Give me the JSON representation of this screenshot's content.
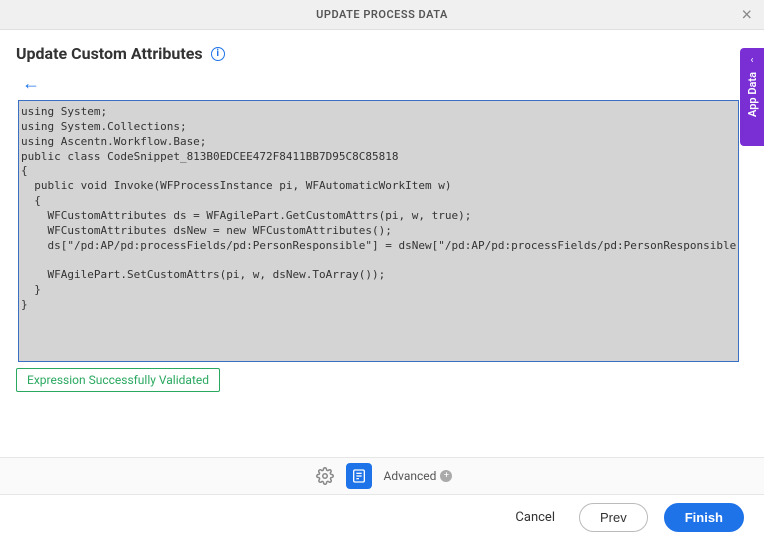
{
  "modal": {
    "title": "UPDATE PROCESS DATA"
  },
  "section": {
    "title": "Update Custom Attributes"
  },
  "code": "using System;\nusing System.Collections;\nusing Ascentn.Workflow.Base;\npublic class CodeSnippet_813B0EDCEE472F8411BB7D95C8C85818\n{\n  public void Invoke(WFProcessInstance pi, WFAutomaticWorkItem w)\n  {\n    WFCustomAttributes ds = WFAgilePart.GetCustomAttrs(pi, w, true);\n    WFCustomAttributes dsNew = new WFCustomAttributes();\n    ds[\"/pd:AP/pd:processFields/pd:PersonResponsible\"] = dsNew[\"/pd:AP/pd:processFields/pd:PersonResponsible\"] = \"Mary Poppins\";\n\n    WFAgilePart.SetCustomAttrs(pi, w, dsNew.ToArray());\n  }\n}",
  "validation": "Expression Successfully Validated",
  "toolbar": {
    "advanced": "Advanced"
  },
  "footer": {
    "cancel": "Cancel",
    "prev": "Prev",
    "finish": "Finish"
  },
  "sidebar": {
    "label": "App Data"
  }
}
